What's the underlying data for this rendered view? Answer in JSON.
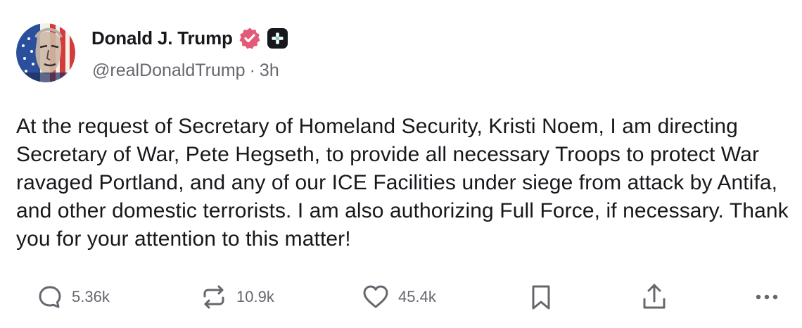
{
  "author": {
    "display_name": "Donald J. Trump",
    "handle": "@realDonaldTrump",
    "time_ago": "3h",
    "separator": "·",
    "verified": true
  },
  "post": {
    "text": "At the request of Secretary of Homeland Security, Kristi Noem, I am directing Secretary of War, Pete Hegseth, to provide all necessary Troops to protect War ravaged Portland, and any of our ICE Facilities under siege from attack by Antifa, and other domestic terrorists. I am also authorizing Full Force, if necessary. Thank you for your attention to this matter!"
  },
  "actions": {
    "replies": "5.36k",
    "reposts": "10.9k",
    "likes": "45.4k"
  },
  "icons": {
    "reply": "speech-bubble-icon",
    "repost": "repost-arrows-icon",
    "like": "heart-icon",
    "bookmark": "bookmark-icon",
    "share": "share-upload-icon",
    "more": "more-dots-icon",
    "verified": "verified-badge-icon",
    "plus": "plus-badge-icon"
  },
  "colors": {
    "text": "#17181c",
    "muted": "#65676e",
    "verified_badge": "#e35a78",
    "plus_badge": "#17181c"
  }
}
